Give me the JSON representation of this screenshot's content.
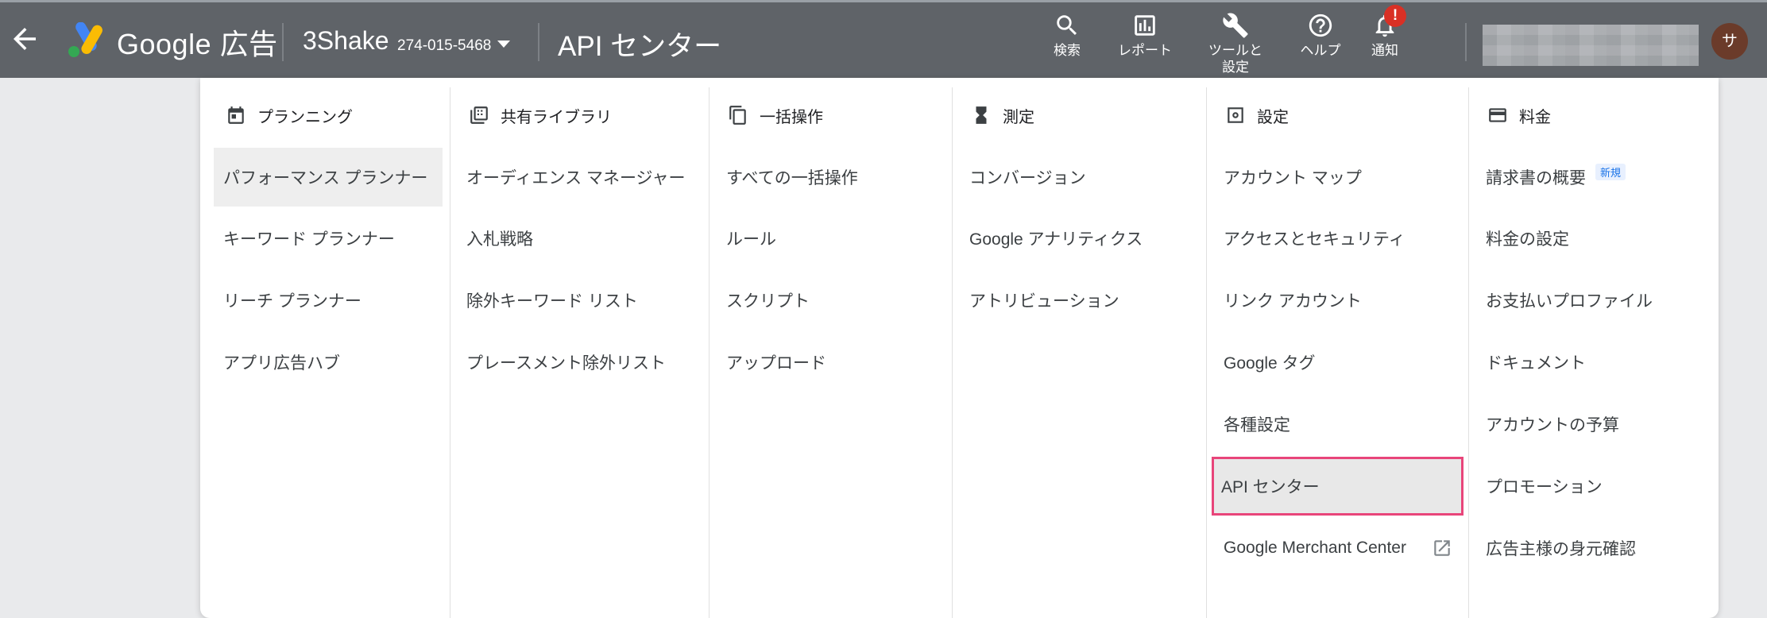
{
  "topbar": {
    "product": "Google 広告",
    "account_name": "3Shake",
    "account_id": "274-015-5468",
    "page_title": "API センター",
    "avatar_initial": "サ",
    "notification_badge": "!",
    "tools": [
      {
        "label": "検索",
        "icon": "search-icon"
      },
      {
        "label": "レポート",
        "icon": "report-icon"
      },
      {
        "label": "ツールと\n設定",
        "icon": "wrench-icon"
      },
      {
        "label": "ヘルプ",
        "icon": "help-icon"
      },
      {
        "label": "通知",
        "icon": "bell-icon"
      }
    ]
  },
  "menu": {
    "columns": [
      {
        "header": "プランニング",
        "icon": "calendar-icon",
        "items": [
          "パフォーマンス プランナー",
          "キーワード プランナー",
          "リーチ プランナー",
          "アプリ広告ハブ"
        ]
      },
      {
        "header": "共有ライブラリ",
        "icon": "library-icon",
        "items": [
          "オーディエンス マネージャー",
          "入札戦略",
          "除外キーワード リスト",
          "プレースメント除外リスト"
        ]
      },
      {
        "header": "一括操作",
        "icon": "copy-icon",
        "items": [
          "すべての一括操作",
          "ルール",
          "スクリプト",
          "アップロード"
        ]
      },
      {
        "header": "測定",
        "icon": "hourglass-icon",
        "items": [
          "コンバージョン",
          "Google アナリティクス",
          "アトリビューション"
        ]
      },
      {
        "header": "設定",
        "icon": "settings-box-icon",
        "items": [
          "アカウント マップ",
          "アクセスとセキュリティ",
          "リンク アカウント",
          "Google タグ",
          "各種設定",
          "API センター",
          "Google Merchant Center"
        ]
      },
      {
        "header": "料金",
        "icon": "credit-card-icon",
        "items": [
          "請求書の概要",
          "料金の設定",
          "お支払いプロファイル",
          "ドキュメント",
          "アカウントの予算",
          "プロモーション",
          "広告主様の身元確認"
        ]
      }
    ],
    "new_badge": "新規",
    "selected_item": "API センター",
    "hovered_item": "パフォーマンス プランナー"
  },
  "colors": {
    "topbar": "#5f6368",
    "selected_outline": "#e8457a",
    "badge": "#d93025"
  }
}
